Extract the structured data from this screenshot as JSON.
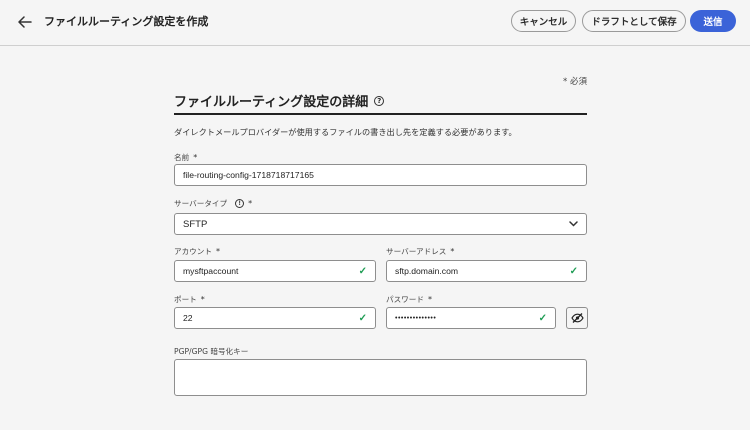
{
  "header": {
    "title": "ファイルルーティング設定を作成",
    "cancel_label": "キャンセル",
    "draft_label": "ドラフトとして保存",
    "send_label": "送信"
  },
  "form": {
    "required_note": "* 必須",
    "section_title": "ファイルルーティング設定の詳細",
    "description": "ダイレクトメールプロバイダーが使用するファイルの書き出し先を定義する必要があります。",
    "name": {
      "label": "名前",
      "value": "file-routing-config-1718718717165"
    },
    "server_type": {
      "label": "サーバータイプ",
      "value": "SFTP"
    },
    "account": {
      "label": "アカウント",
      "value": "mysftpaccount"
    },
    "server_address": {
      "label": "サーバーアドレス",
      "value": "sftp.domain.com"
    },
    "port": {
      "label": "ポート",
      "value": "22"
    },
    "password": {
      "label": "パスワード",
      "value": "••••••••••••••"
    },
    "pgp_key": {
      "label": "PGP/GPG 暗号化キー",
      "value": ""
    }
  },
  "colors": {
    "primary": "#3b63d8",
    "valid": "#1f9d55"
  },
  "icons": [
    "back-arrow-icon",
    "help-icon",
    "chevron-down-icon",
    "checkmark-icon",
    "eye-off-icon"
  ]
}
